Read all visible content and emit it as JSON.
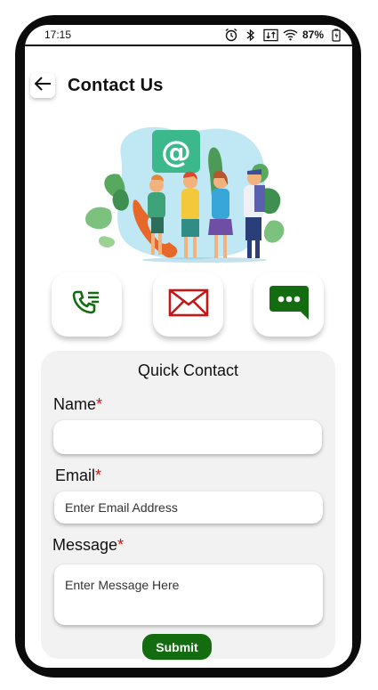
{
  "status_bar": {
    "time": "17:15",
    "battery": "87%",
    "icons": [
      "alarm-icon",
      "bluetooth-icon",
      "data-transfer-icon",
      "wifi-icon",
      "battery-icon"
    ]
  },
  "header": {
    "title": "Contact Us",
    "back_icon": "arrow-left-icon"
  },
  "illustration": {
    "badge_text": "@"
  },
  "contact_options": [
    {
      "icon": "phone-list-icon",
      "color": "#136d10"
    },
    {
      "icon": "envelope-icon",
      "color": "#c41818"
    },
    {
      "icon": "chat-bubble-icon",
      "color": "#136d10"
    }
  ],
  "form": {
    "title": "Quick Contact",
    "required_marker": "*",
    "name": {
      "label": "Name",
      "value": "",
      "placeholder": ""
    },
    "email": {
      "label": "Email",
      "placeholder": "Enter Email Address"
    },
    "message": {
      "label": "Message",
      "placeholder": "Enter Message Here"
    },
    "submit_label": "Submit"
  },
  "colors": {
    "accent_green": "#136d10",
    "required_red": "#d11111",
    "card_background": "#f2f2f2",
    "frame": "#0b0b0b"
  }
}
